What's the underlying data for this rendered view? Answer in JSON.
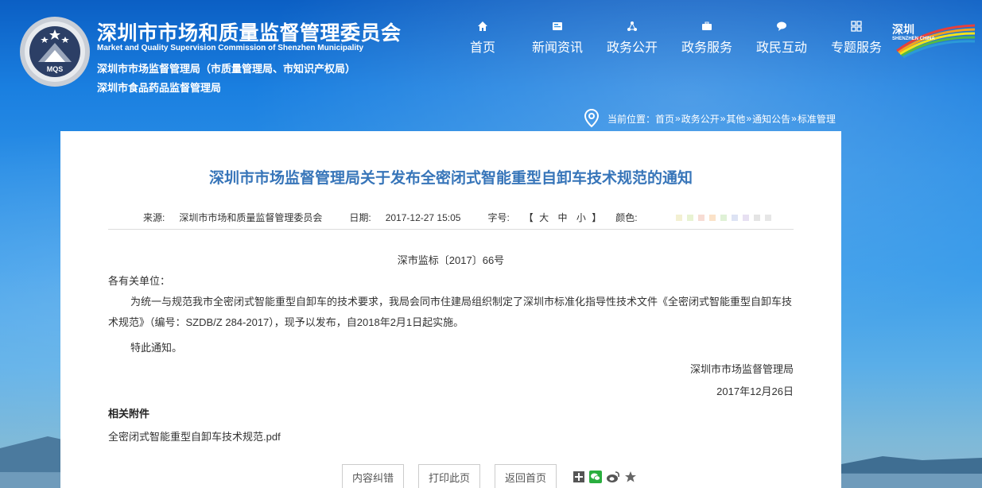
{
  "header": {
    "title_cn": "深圳市市场和质量监督管理委员会",
    "title_en": "Market and Quality Supervision Commission of Shenzhen Municipality",
    "subtitle_1": "深圳市市场监督管理局（市质量管理局、市知识产权局）",
    "subtitle_2": "深圳市食品药品监督管理局",
    "logo_text": "MQS",
    "city_logo_cn": "深圳",
    "city_logo_en": "SHENZHEN CHINA"
  },
  "nav": [
    {
      "label": "首页",
      "icon": "home-icon"
    },
    {
      "label": "新闻资讯",
      "icon": "news-icon"
    },
    {
      "label": "政务公开",
      "icon": "share-network-icon"
    },
    {
      "label": "政务服务",
      "icon": "briefcase-icon"
    },
    {
      "label": "政民互动",
      "icon": "chat-icon"
    },
    {
      "label": "专题服务",
      "icon": "grid-icon"
    }
  ],
  "breadcrumb": {
    "prefix": "当前位置：",
    "items": [
      "首页",
      "政务公开",
      "其他",
      "通知公告",
      "标准管理"
    ],
    "separator": "»"
  },
  "article": {
    "title": "深圳市市场监督管理局关于发布全密闭式智能重型自卸车技术规范的通知",
    "meta": {
      "source_label": "来源:",
      "source": "深圳市市场和质量监督管理委员会",
      "date_label": "日期:",
      "date": "2017-12-27 15:05",
      "size_label": "字号:",
      "size_open": "【",
      "size_options": [
        "大",
        "中",
        "小"
      ],
      "size_close": "】",
      "color_label": "颜色:",
      "swatches": [
        "#f3f0d2",
        "#e8f3d2",
        "#f7dcd4",
        "#fbe2c8",
        "#dff1d6",
        "#dde3f4",
        "#e7e0f2",
        "#e4e4e4",
        "#e6e6e6"
      ]
    },
    "doc_no": "深市监标〔2017〕66号",
    "salutation": "各有关单位：",
    "body": "为统一与规范我市全密闭式智能重型自卸车的技术要求，我局会同市住建局组织制定了深圳市标准化指导性技术文件《全密闭式智能重型自卸车技术规范》（编号：SZDB/Z 284-2017），现予以发布，自2018年2月1日起实施。",
    "closing": "特此通知。",
    "signature_org": "深圳市市场监督管理局",
    "signature_date": "2017年12月26日",
    "attachments_label": "相关附件",
    "attachment_file": "全密闭式智能重型自卸车技术规范.pdf"
  },
  "actions": {
    "report_error": "内容纠错",
    "print": "打印此页",
    "back_home": "返回首页"
  },
  "share_icons": [
    "share-plus-icon",
    "wechat-icon",
    "weibo-icon",
    "favorite-icon"
  ]
}
